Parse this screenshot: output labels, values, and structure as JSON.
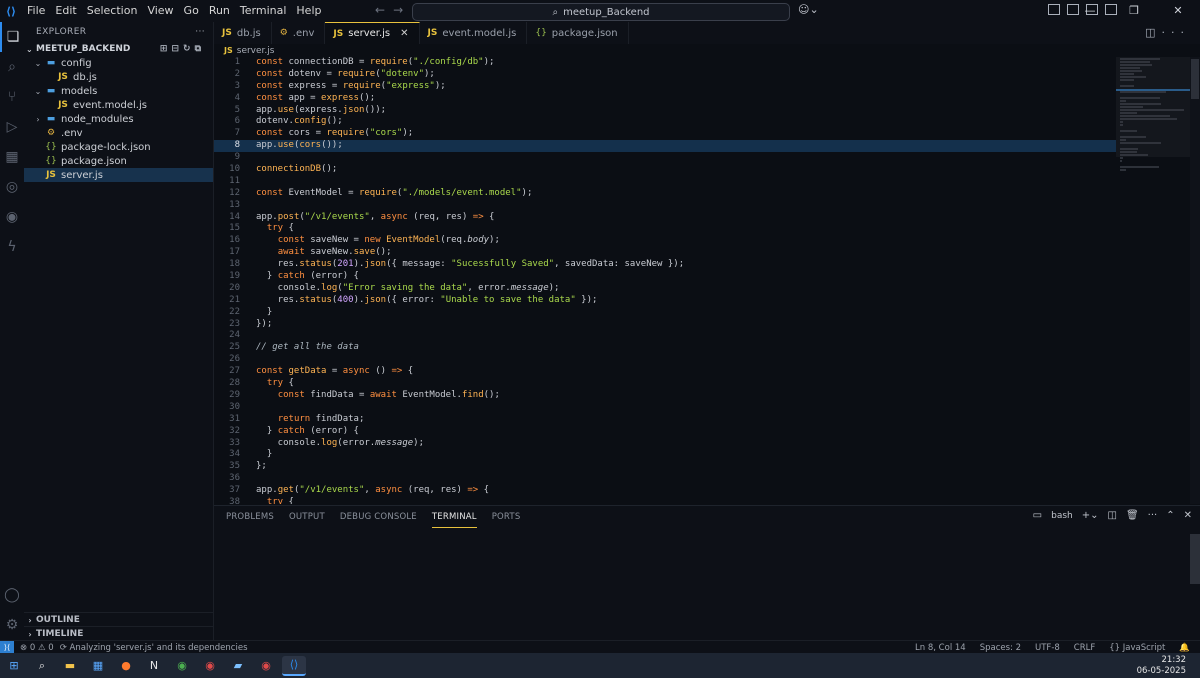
{
  "menu": [
    "File",
    "Edit",
    "Selection",
    "View",
    "Go",
    "Run",
    "Terminal",
    "Help"
  ],
  "command_center": "meetup_Backend",
  "explorer": {
    "title": "EXPLORER",
    "project": "MEETUP_BACKEND",
    "tree": [
      {
        "label": "config",
        "type": "folder",
        "open": true,
        "depth": 0
      },
      {
        "label": "db.js",
        "type": "js",
        "depth": 1
      },
      {
        "label": "models",
        "type": "folder",
        "open": true,
        "depth": 0
      },
      {
        "label": "event.model.js",
        "type": "js",
        "depth": 1
      },
      {
        "label": "node_modules",
        "type": "folder",
        "open": false,
        "depth": 0
      },
      {
        "label": ".env",
        "type": "env",
        "depth": 0
      },
      {
        "label": "package-lock.json",
        "type": "json",
        "depth": 0
      },
      {
        "label": "package.json",
        "type": "json",
        "depth": 0
      },
      {
        "label": "server.js",
        "type": "js",
        "depth": 0,
        "selected": true
      }
    ],
    "outline": "OUTLINE",
    "timeline": "TIMELINE"
  },
  "tabs": [
    {
      "label": "db.js",
      "type": "js",
      "active": false
    },
    {
      "label": ".env",
      "type": "env",
      "active": false
    },
    {
      "label": "server.js",
      "type": "js",
      "active": true
    },
    {
      "label": "event.model.js",
      "type": "js",
      "active": false
    },
    {
      "label": "package.json",
      "type": "json",
      "active": false
    }
  ],
  "breadcrumb": "server.js",
  "current_line": 8,
  "code": [
    [
      [
        "kw",
        "const"
      ],
      [
        "",
        " connectionDB = "
      ],
      [
        "fn",
        "require"
      ],
      [
        "",
        "("
      ],
      [
        "st",
        "\"./config/db\""
      ],
      [
        "",
        ");"
      ]
    ],
    [
      [
        "kw",
        "const"
      ],
      [
        "",
        " dotenv = "
      ],
      [
        "fn",
        "require"
      ],
      [
        "",
        "("
      ],
      [
        "st",
        "\"dotenv\""
      ],
      [
        "",
        ");"
      ]
    ],
    [
      [
        "kw",
        "const"
      ],
      [
        "",
        " express = "
      ],
      [
        "fn",
        "require"
      ],
      [
        "",
        "("
      ],
      [
        "st",
        "\"express\""
      ],
      [
        "",
        ");"
      ]
    ],
    [
      [
        "kw",
        "const"
      ],
      [
        "",
        " app = "
      ],
      [
        "fn",
        "express"
      ],
      [
        "",
        "();"
      ]
    ],
    [
      [
        "",
        "app."
      ],
      [
        "fn",
        "use"
      ],
      [
        "",
        "(express."
      ],
      [
        "fn",
        "json"
      ],
      [
        "",
        "());"
      ]
    ],
    [
      [
        "",
        "dotenv."
      ],
      [
        "fn",
        "config"
      ],
      [
        "",
        "();"
      ]
    ],
    [
      [
        "kw",
        "const"
      ],
      [
        "",
        " cors = "
      ],
      [
        "fn",
        "require"
      ],
      [
        "",
        "("
      ],
      [
        "st",
        "\"cors\""
      ],
      [
        "",
        ");"
      ]
    ],
    [
      [
        "",
        "app."
      ],
      [
        "fn",
        "use"
      ],
      [
        "",
        "("
      ],
      [
        "fn",
        "cors"
      ],
      [
        "",
        "());"
      ]
    ],
    [],
    [
      [
        "fn",
        "connectionDB"
      ],
      [
        "",
        "();"
      ]
    ],
    [],
    [
      [
        "kw",
        "const"
      ],
      [
        "",
        " EventModel = "
      ],
      [
        "fn",
        "require"
      ],
      [
        "",
        "("
      ],
      [
        "st",
        "\"./models/event.model\""
      ],
      [
        "",
        ");"
      ]
    ],
    [],
    [
      [
        "",
        "app."
      ],
      [
        "fn",
        "post"
      ],
      [
        "",
        "("
      ],
      [
        "st",
        "\"/v1/events\""
      ],
      [
        "",
        ", "
      ],
      [
        "kw",
        "async"
      ],
      [
        "",
        " (req, res) "
      ],
      [
        "kw",
        "=>"
      ],
      [
        "",
        " {"
      ]
    ],
    [
      [
        "",
        "  "
      ],
      [
        "kw",
        "try"
      ],
      [
        "",
        " {"
      ]
    ],
    [
      [
        "",
        "    "
      ],
      [
        "kw",
        "const"
      ],
      [
        "",
        " saveNew = "
      ],
      [
        "kw",
        "new"
      ],
      [
        "",
        " "
      ],
      [
        "fn",
        "EventModel"
      ],
      [
        "",
        "(req."
      ],
      [
        "it",
        "body"
      ],
      [
        "",
        ");"
      ]
    ],
    [
      [
        "",
        "    "
      ],
      [
        "kw",
        "await"
      ],
      [
        "",
        " saveNew."
      ],
      [
        "fn",
        "save"
      ],
      [
        "",
        "();"
      ]
    ],
    [
      [
        "",
        "    res."
      ],
      [
        "fn",
        "status"
      ],
      [
        "",
        "("
      ],
      [
        "nm",
        "201"
      ],
      [
        "",
        ")."
      ],
      [
        "fn",
        "json"
      ],
      [
        "",
        "({ message: "
      ],
      [
        "st",
        "\"Sucessfully Saved\""
      ],
      [
        "",
        ", savedData: saveNew });"
      ]
    ],
    [
      [
        "",
        "  } "
      ],
      [
        "kw",
        "catch"
      ],
      [
        "",
        " (error) {"
      ]
    ],
    [
      [
        "",
        "    console."
      ],
      [
        "fn",
        "log"
      ],
      [
        "",
        "("
      ],
      [
        "st",
        "\"Error saving the data\""
      ],
      [
        "",
        ", error."
      ],
      [
        "it",
        "message"
      ],
      [
        "",
        ");"
      ]
    ],
    [
      [
        "",
        "    res."
      ],
      [
        "fn",
        "status"
      ],
      [
        "",
        "("
      ],
      [
        "nm",
        "400"
      ],
      [
        "",
        ")."
      ],
      [
        "fn",
        "json"
      ],
      [
        "",
        "({ error: "
      ],
      [
        "st",
        "\"Unable to save the data\""
      ],
      [
        "",
        " });"
      ]
    ],
    [
      [
        "",
        "  }"
      ]
    ],
    [
      [
        "",
        "});"
      ]
    ],
    [],
    [
      [
        "cm",
        "// get all the data"
      ]
    ],
    [],
    [
      [
        "kw",
        "const"
      ],
      [
        "",
        " "
      ],
      [
        "fn",
        "getData"
      ],
      [
        "",
        " = "
      ],
      [
        "kw",
        "async"
      ],
      [
        "",
        " () "
      ],
      [
        "kw",
        "=>"
      ],
      [
        "",
        " {"
      ]
    ],
    [
      [
        "",
        "  "
      ],
      [
        "kw",
        "try"
      ],
      [
        "",
        " {"
      ]
    ],
    [
      [
        "",
        "    "
      ],
      [
        "kw",
        "const"
      ],
      [
        "",
        " findData = "
      ],
      [
        "kw",
        "await"
      ],
      [
        "",
        " EventModel."
      ],
      [
        "fn",
        "find"
      ],
      [
        "",
        "();"
      ]
    ],
    [],
    [
      [
        "",
        "    "
      ],
      [
        "kw",
        "return"
      ],
      [
        "",
        " findData;"
      ]
    ],
    [
      [
        "",
        "  } "
      ],
      [
        "kw",
        "catch"
      ],
      [
        "",
        " (error) {"
      ]
    ],
    [
      [
        "",
        "    console."
      ],
      [
        "fn",
        "log"
      ],
      [
        "",
        "(error."
      ],
      [
        "it",
        "message"
      ],
      [
        "",
        ");"
      ]
    ],
    [
      [
        "",
        "  }"
      ]
    ],
    [
      [
        "",
        "};"
      ]
    ],
    [],
    [
      [
        "",
        "app."
      ],
      [
        "fn",
        "get"
      ],
      [
        "",
        "("
      ],
      [
        "st",
        "\"/v1/events\""
      ],
      [
        "",
        ", "
      ],
      [
        "kw",
        "async"
      ],
      [
        "",
        " (req, res) "
      ],
      [
        "kw",
        "=>"
      ],
      [
        "",
        " {"
      ]
    ],
    [
      [
        "",
        "  "
      ],
      [
        "kw",
        "try"
      ],
      [
        "",
        " {"
      ]
    ]
  ],
  "panel": {
    "tabs": [
      "PROBLEMS",
      "OUTPUT",
      "DEBUG CONSOLE",
      "TERMINAL",
      "PORTS"
    ],
    "active_tab": "TERMINAL",
    "shell": "bash"
  },
  "status": {
    "message": "Analyzing 'server.js' and its dependencies",
    "errors": "0",
    "warnings": "0",
    "position": "Ln 8, Col 14",
    "spaces": "Spaces: 2",
    "encoding": "UTF-8",
    "eol": "CRLF",
    "language": "{} JavaScript"
  },
  "taskbar": {
    "time": "21:32",
    "date": "06-05-2025",
    "apps": [
      "windows-start",
      "search",
      "file-explorer",
      "store",
      "firefox",
      "notion",
      "chrome",
      "chrome-profile",
      "notes",
      "chrome-alt",
      "vscode"
    ]
  }
}
